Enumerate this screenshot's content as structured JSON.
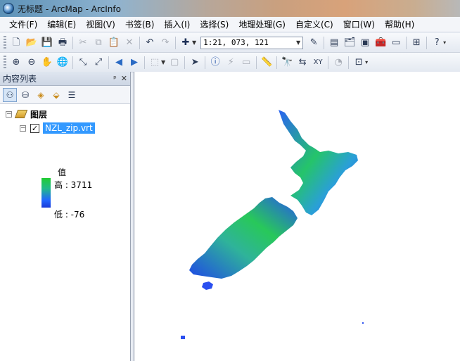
{
  "window": {
    "title": "无标题 - ArcMap - ArcInfo"
  },
  "menu": [
    "文件(F)",
    "编辑(E)",
    "视图(V)",
    "书签(B)",
    "插入(I)",
    "选择(S)",
    "地理处理(G)",
    "自定义(C)",
    "窗口(W)",
    "帮助(H)"
  ],
  "toolbar": {
    "scale": "1:21, 073, 121"
  },
  "toc": {
    "title": "内容列表",
    "pin_label": "ᵖ",
    "close_label": "✕",
    "root_label": "图层",
    "layer": {
      "name": "NZL_zip.vrt",
      "checked": "✓",
      "legend_title": "值",
      "high_label": "高 : 3711",
      "low_label": "低 : -76"
    }
  },
  "icons": {
    "app": "arcmap-globe-icon",
    "colors": {
      "ramp_high": "#22cc33",
      "ramp_low": "#1a3ad8",
      "selected_layer": "#3399ff"
    }
  }
}
